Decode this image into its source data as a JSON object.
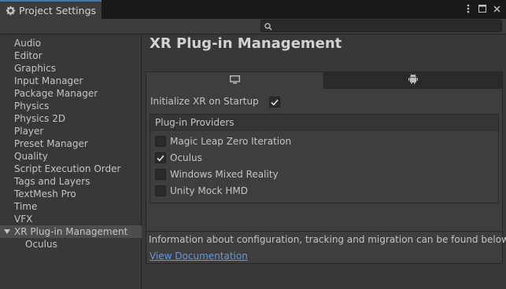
{
  "window": {
    "tab_title": "Project Settings"
  },
  "search": {
    "placeholder": ""
  },
  "sidebar": {
    "items": [
      {
        "label": "Audio"
      },
      {
        "label": "Editor"
      },
      {
        "label": "Graphics"
      },
      {
        "label": "Input Manager"
      },
      {
        "label": "Package Manager"
      },
      {
        "label": "Physics"
      },
      {
        "label": "Physics 2D"
      },
      {
        "label": "Player"
      },
      {
        "label": "Preset Manager"
      },
      {
        "label": "Quality"
      },
      {
        "label": "Script Execution Order"
      },
      {
        "label": "Tags and Layers"
      },
      {
        "label": "TextMesh Pro"
      },
      {
        "label": "Time"
      },
      {
        "label": "VFX"
      },
      {
        "label": "XR Plug-in Management",
        "selected": true,
        "expanded": true
      },
      {
        "label": "Oculus",
        "child": true
      }
    ]
  },
  "main": {
    "title": "XR Plug-in Management",
    "platform_tabs": [
      {
        "icon": "monitor-icon",
        "active": true
      },
      {
        "icon": "android-icon",
        "active": false
      }
    ],
    "init_label": "Initialize XR on Startup",
    "init_checked": true,
    "providers_header": "Plug-in Providers",
    "providers": [
      {
        "label": "Magic Leap Zero Iteration",
        "checked": false
      },
      {
        "label": "Oculus",
        "checked": true
      },
      {
        "label": "Windows Mixed Reality",
        "checked": false
      },
      {
        "label": "Unity Mock HMD",
        "checked": false
      }
    ],
    "info_text": "Information about configuration, tracking and migration can be found below.",
    "doc_link": "View Documentation"
  },
  "colors": {
    "background": "#383838",
    "selection": "#4d4d4d",
    "accent_tab": "#3a79bb",
    "link": "#5b9de8"
  }
}
